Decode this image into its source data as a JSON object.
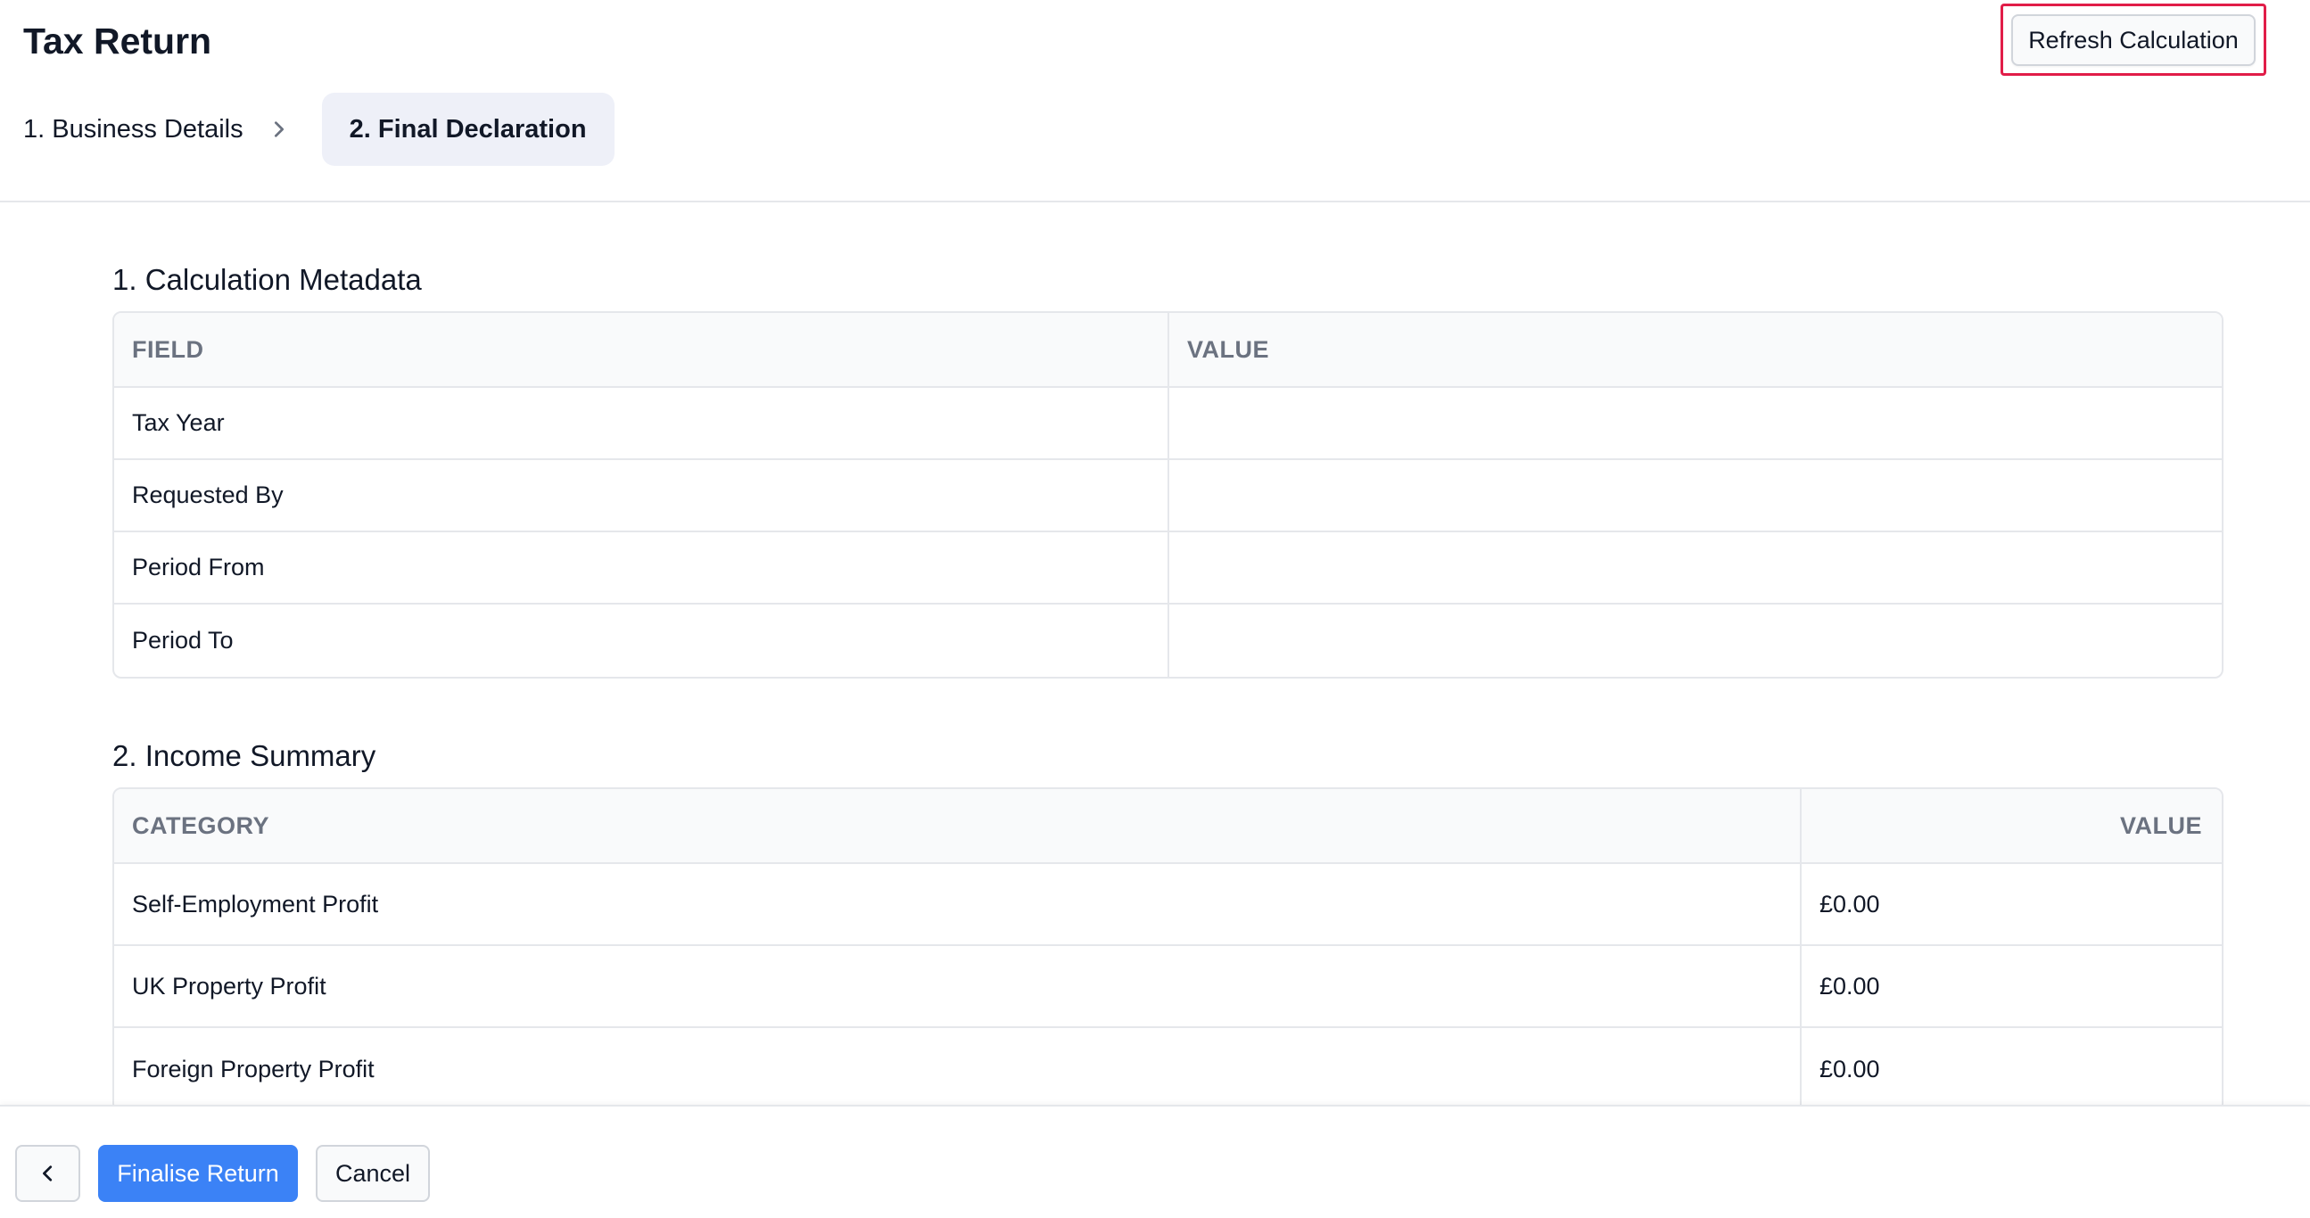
{
  "header": {
    "title": "Tax Return",
    "refresh_label": "Refresh Calculation",
    "steps": [
      {
        "label": "1. Business Details",
        "active": false
      },
      {
        "label": "2. Final Declaration",
        "active": true
      }
    ]
  },
  "metadata": {
    "title": "1. Calculation Metadata",
    "columns": [
      "FIELD",
      "VALUE"
    ],
    "rows": [
      {
        "field": "Tax Year",
        "value": ""
      },
      {
        "field": "Requested By",
        "value": ""
      },
      {
        "field": "Period From",
        "value": ""
      },
      {
        "field": "Period To",
        "value": ""
      }
    ]
  },
  "income": {
    "title": "2. Income Summary",
    "columns": [
      "CATEGORY",
      "VALUE"
    ],
    "rows": [
      {
        "category": "Self-Employment Profit",
        "value": "£0.00"
      },
      {
        "category": "UK Property Profit",
        "value": "£0.00"
      },
      {
        "category": "Foreign Property Profit",
        "value": "£0.00"
      }
    ]
  },
  "footer": {
    "back_icon": "chevron-left-icon",
    "finalise_label": "Finalise Return",
    "cancel_label": "Cancel"
  },
  "colors": {
    "accent": "#3b82f6",
    "highlight": "#e11d48",
    "active_step_bg": "#eef0f8"
  }
}
